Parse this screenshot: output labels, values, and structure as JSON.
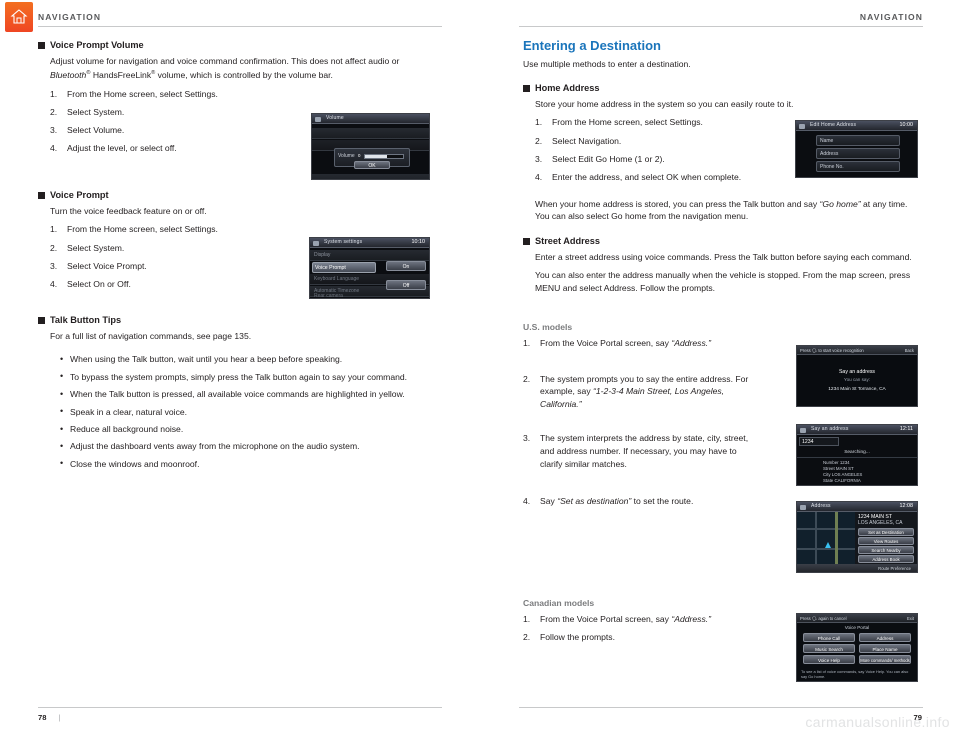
{
  "header": {
    "left_title": "NAVIGATION",
    "right_title": "NAVIGATION",
    "home_icon": "home-icon"
  },
  "footer": {
    "left_page": "78",
    "left_divider": "|",
    "right_page": "79",
    "watermark": "carmanualsonline.info"
  },
  "left_column": {
    "sections": [
      {
        "heading": "Voice Prompt Volume",
        "body_html": "Adjust volume for navigation and voice command confirmation. This does not affect audio or <i>Bluetooth</i><sup>®</sup> HandsFreeLink<sup>®</sup> volume, which is controlled by the volume bar.",
        "steps": [
          "From the Home screen, select Settings.",
          "Select System.",
          "Select Volume.",
          "Adjust the level, or select off."
        ]
      },
      {
        "heading": "Voice Prompt",
        "body": "Turn the voice feedback feature on or off.",
        "steps": [
          "From the Home screen, select Settings.",
          "Select System.",
          "Select Voice Prompt.",
          "Select On or Off."
        ]
      },
      {
        "heading": "Talk Button Tips",
        "body": "For a full list of navigation commands, see page 135.",
        "bullets": [
          "When using the Talk button, wait until you hear a beep before speaking.",
          "To bypass the system prompts, simply press the Talk button again to say your command.",
          "When the Talk button is pressed, all available voice commands are highlighted in yellow.",
          "Speak in a clear, natural voice.",
          "Reduce all background noise.",
          "Adjust the dashboard vents away from the microphone on the audio system.",
          "Close the windows and moonroof."
        ]
      }
    ],
    "screens": {
      "volume": {
        "title": "Volume",
        "label": "Volume",
        "value_label": "Volume",
        "ok_label": "OK"
      },
      "system_settings": {
        "title": "System settings",
        "clock": "10:10",
        "rows": [
          "Display",
          "Voice Prompt",
          "Keyboard Language",
          "Automatic Timezone",
          "Rear camera"
        ],
        "selected_row": "Voice Prompt",
        "buttons": [
          "On",
          "Off"
        ]
      }
    }
  },
  "right_column": {
    "title": "Entering a Destination",
    "intro": "Use multiple methods to enter a destination.",
    "sections": [
      {
        "heading": "Home Address",
        "body": "Store your home address in the system so you can easily route to it.",
        "steps": [
          "From the Home screen, select Settings.",
          "Select Navigation.",
          "Select Edit Go Home (1 or 2).",
          "Enter the address, and select OK when complete."
        ],
        "note_html": "When your home address is stored, you can press the Talk button and say <i>“Go home”</i> at any time. You can also select Go home from the navigation menu."
      },
      {
        "heading": "Street Address",
        "body1": "Enter a street address using voice commands. Press the Talk button before saying each command.",
        "body2": "You can also enter the address manually when the vehicle is stopped. From the map screen, press MENU and select Address. Follow the prompts."
      }
    ],
    "us_models": {
      "label": "U.S. models",
      "steps": [
        {
          "text_html": "From the Voice Portal screen, say <i>“Address.”</i>"
        },
        {
          "text_html": "The system prompts you to say the entire address. For example, say <i>“1-2-3-4 Main Street, Los Angeles, California.”</i>"
        },
        {
          "text_html": "The system interprets the address by state, city, street, and address number. If necessary, you may have to clarify similar matches."
        },
        {
          "text_html": "Say <i>“Set as destination”</i> to set the route."
        }
      ]
    },
    "canadian_models": {
      "label": "Canadian models",
      "steps": [
        {
          "text_html": "From the Voice Portal screen, say <i>“Address.”</i>"
        },
        {
          "text_html": "Follow the prompts."
        }
      ]
    },
    "screens": {
      "edit_home": {
        "title": "Edit Home Address",
        "clock": "10:00",
        "rows": [
          "Name",
          "Address",
          "Phone No."
        ]
      },
      "voice_reco": {
        "hint_left": "Press 🗣 to start voice recognition",
        "hint_right": "Back",
        "line1": "Say an address",
        "line2": "You can say:",
        "line3": "1234 Main St  Torrance, CA"
      },
      "say_address": {
        "title": "Say an address",
        "clock": "12:11",
        "input": "1234",
        "searching": "Searching...",
        "fields": [
          "Number 1234",
          "Street MAIN ST",
          "City LOS ANGELES",
          "State CALIFORNIA"
        ]
      },
      "address_result": {
        "title": "Address",
        "clock": "12:08",
        "addr1": "1234 MAIN ST",
        "addr2": "LOS ANGELES, CA",
        "menu": [
          "Set as Destination",
          "View Routes",
          "Search Nearby",
          "Address Book"
        ],
        "footer": "Route Preference"
      },
      "voice_portal": {
        "hint_left": "Press 🗣 again to cancel",
        "hint_right": "Exit",
        "title": "Voice Portal",
        "items": [
          "Phone Call",
          "Address",
          "Music Search",
          "Place Name",
          "Voice Help",
          "More commands/ methods"
        ],
        "footer": "To see a list of voice commands, say  Voice Help. You can also say  Go home."
      }
    }
  }
}
